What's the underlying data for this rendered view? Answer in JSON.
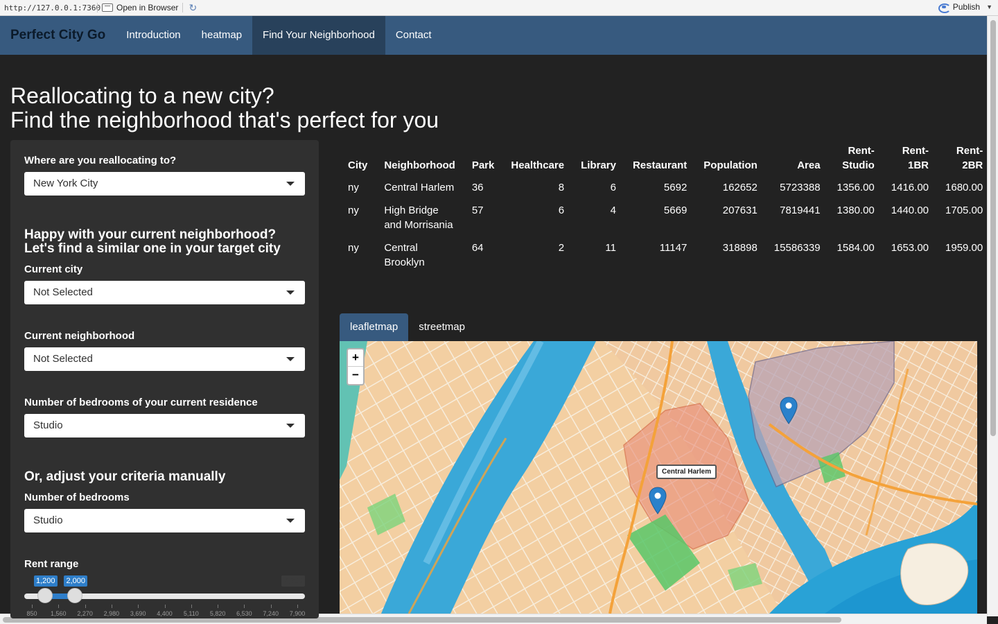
{
  "toolbar": {
    "url": "http://127.0.0.1:7360",
    "open_label": "Open in Browser",
    "publish_label": "Publish"
  },
  "nav": {
    "brand": "Perfect City Go",
    "items": [
      {
        "label": "Introduction"
      },
      {
        "label": "heatmap"
      },
      {
        "label": "Find Your Neighborhood"
      },
      {
        "label": "Contact"
      }
    ]
  },
  "heading": {
    "line1": "Reallocating to a new city?",
    "line2": "Find the neighborhood that's perfect for you"
  },
  "sidebar": {
    "target_city_label": "Where are you reallocating to?",
    "target_city_value": "New York City",
    "match_heading": "Happy with your current neighborhood? Let's find a similar one in your target city",
    "current_city_label": "Current city",
    "current_city_value": "Not Selected",
    "current_neighborhood_label": "Current neighborhood",
    "current_neighborhood_value": "Not Selected",
    "bedrooms_current_label": "Number of bedrooms of your current residence",
    "bedrooms_current_value": "Studio",
    "manual_heading": "Or, adjust your criteria manually",
    "bedrooms_label": "Number of bedrooms",
    "bedrooms_value": "Studio",
    "rent_label": "Rent range",
    "rent_slider": {
      "min": 850,
      "max": 7900,
      "from": 1200,
      "to": 2000,
      "from_label": "1,200",
      "to_label": "2,000",
      "max_label": "7,900",
      "ticks": [
        "850",
        "1,560",
        "2,270",
        "2,980",
        "3,690",
        "4,400",
        "5,110",
        "5,820",
        "6,530",
        "7,240",
        "7,900"
      ]
    }
  },
  "table": {
    "headers": [
      "City",
      "Neighborhood",
      "Park",
      "Healthcare",
      "Library",
      "Restaurant",
      "Population",
      "Area",
      "Rent-Studio",
      "Rent-1BR",
      "Rent-2BR"
    ],
    "rows": [
      [
        "ny",
        "Central Harlem",
        "36",
        "8",
        "6",
        "5692",
        "162652",
        "5723388",
        "1356.00",
        "1416.00",
        "1680.00"
      ],
      [
        "ny",
        "High Bridge and Morrisania",
        "57",
        "6",
        "4",
        "5669",
        "207631",
        "7819441",
        "1380.00",
        "1440.00",
        "1705.00"
      ],
      [
        "ny",
        "Central Brooklyn",
        "64",
        "2",
        "11",
        "11147",
        "318898",
        "15586339",
        "1584.00",
        "1653.00",
        "1959.00"
      ]
    ]
  },
  "tabs": [
    {
      "label": "leafletmap"
    },
    {
      "label": "streetmap"
    }
  ],
  "map": {
    "zoom_in": "+",
    "zoom_out": "−",
    "popup_label": "Central Harlem",
    "marker_color": "#2a81cb"
  }
}
